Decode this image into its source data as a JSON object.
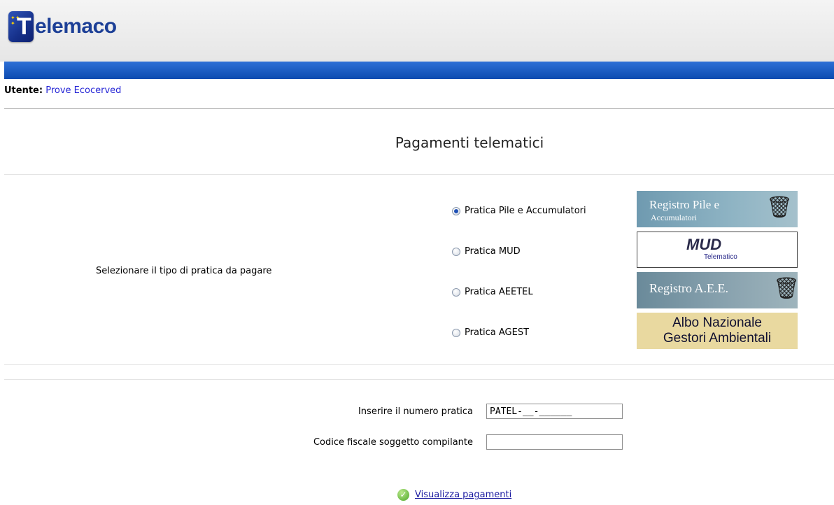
{
  "app": {
    "logo_letter": "T",
    "name": "elemaco"
  },
  "user": {
    "label": "Utente:",
    "name": "Prove Ecocerved"
  },
  "page_title": "Pagamenti telematici",
  "selection": {
    "prompt": "Selezionare il tipo di pratica da pagare",
    "options": [
      {
        "label": "Pratica Pile e Accumulatori",
        "checked": true,
        "banner_line1": "Registro Pile e",
        "banner_line2": "Accumulatori"
      },
      {
        "label": "Pratica MUD",
        "checked": false,
        "banner_line1": "MUD",
        "banner_line2": "Telematico"
      },
      {
        "label": "Pratica AEETEL",
        "checked": false,
        "banner_line1": "Registro A.E.E."
      },
      {
        "label": "Pratica AGEST",
        "checked": false,
        "banner_line1": "Albo Nazionale",
        "banner_line2": "Gestori Ambientali"
      }
    ]
  },
  "form": {
    "numero_label": "Inserire il numero pratica",
    "numero_value": "PATEL-__-______",
    "cf_label": "Codice fiscale soggetto compilante",
    "cf_value": ""
  },
  "action": {
    "label": "Visualizza pagamenti"
  },
  "colors": {
    "bluebar": "#1a5cc4",
    "link": "#1a1aa0",
    "username": "#2626d6"
  }
}
